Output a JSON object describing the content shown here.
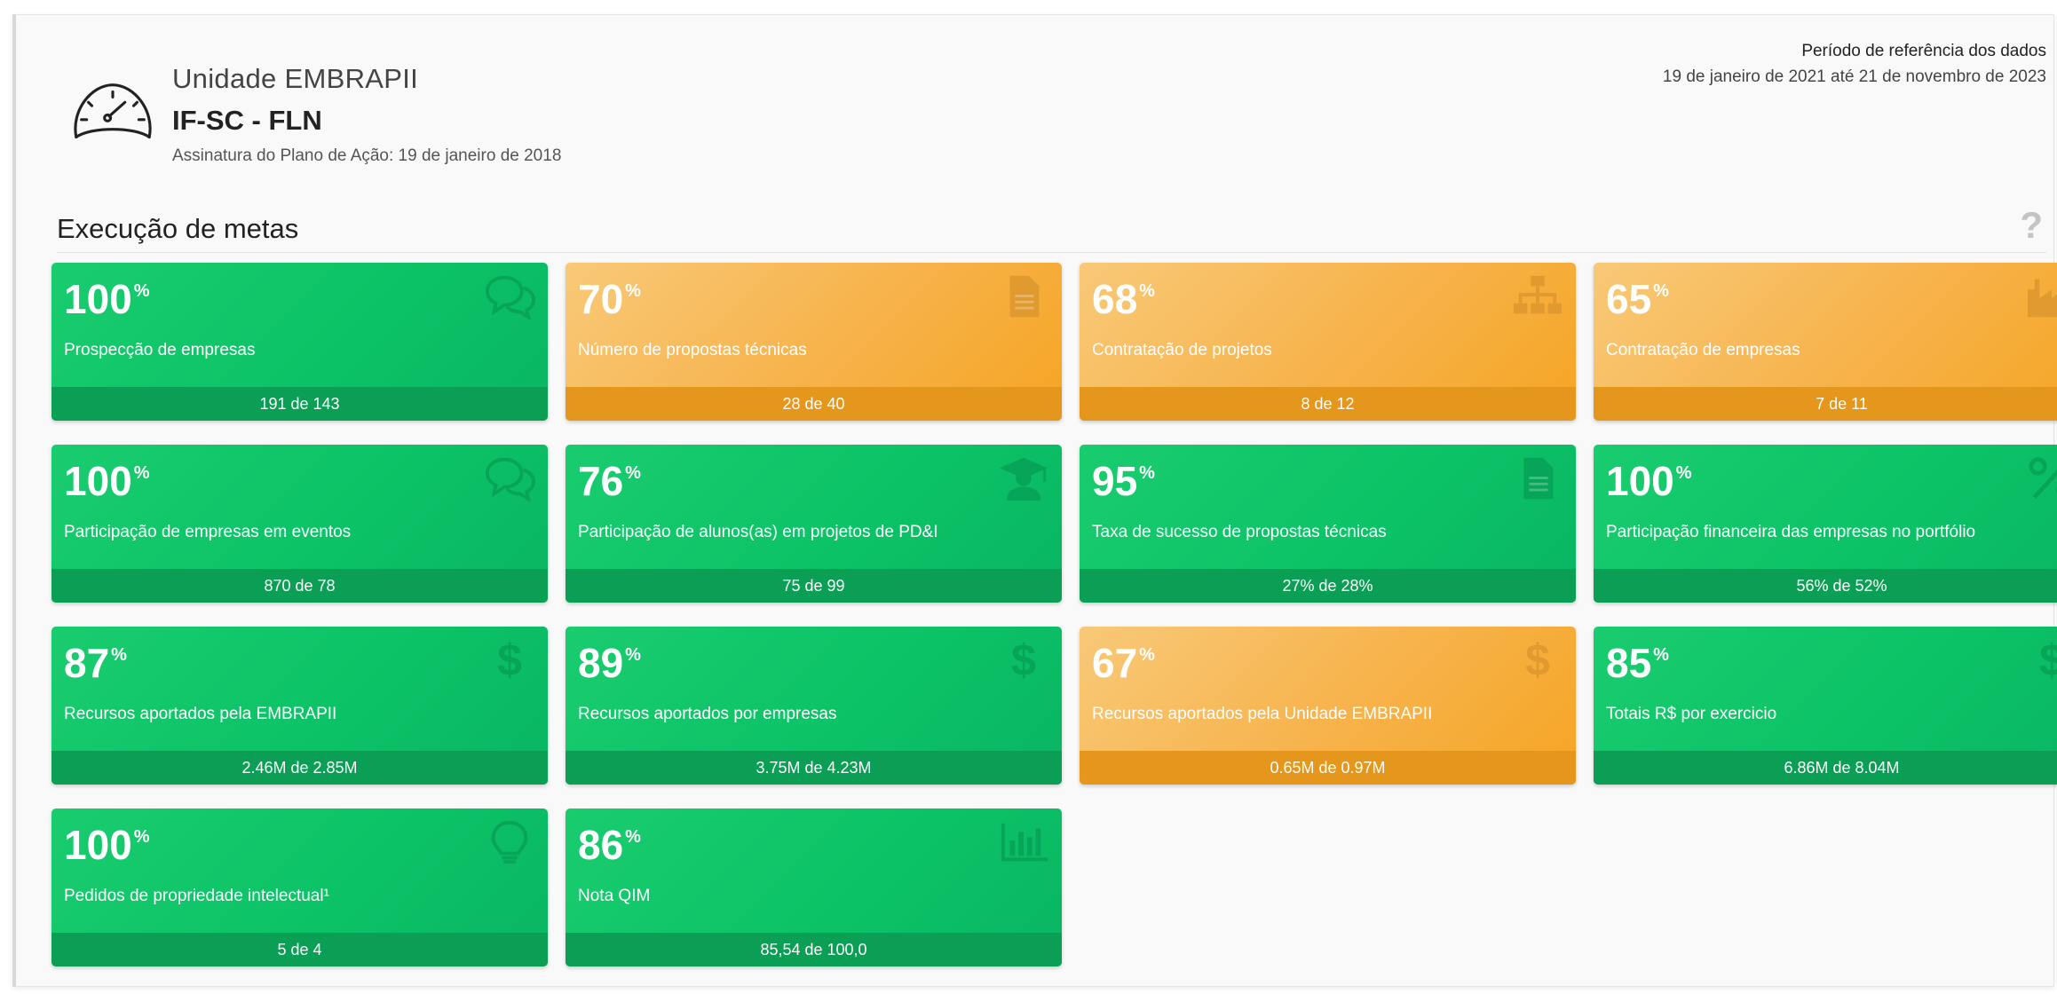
{
  "header": {
    "unit_label": "Unidade EMBRAPII",
    "unit_name": "IF-SC - FLN",
    "signature": "Assinatura do Plano de Ação: 19 de janeiro de 2018",
    "period_title": "Período de referência dos dados",
    "period_range": "19 de janeiro de 2021 até 21 de novembro de 2023",
    "icon": "speedometer-icon"
  },
  "section": {
    "title": "Execução de metas",
    "help_icon": "?"
  },
  "colors": {
    "green": "#0bc266",
    "green_footer": "#0a9f55",
    "orange": "#f7b24a",
    "orange_footer": "#e5961c"
  },
  "cards": [
    {
      "pct": "100",
      "sign": "%",
      "label": "Prospecção de empresas",
      "footer": "191 de 143",
      "status": "green",
      "icon": "chat-bubbles-icon"
    },
    {
      "pct": "70",
      "sign": "%",
      "label": "Número de propostas técnicas",
      "footer": "28 de 40",
      "status": "orange",
      "icon": "document-icon"
    },
    {
      "pct": "68",
      "sign": "%",
      "label": "Contratação de projetos",
      "footer": "8 de 12",
      "status": "orange",
      "icon": "org-chart-icon"
    },
    {
      "pct": "65",
      "sign": "%",
      "label": "Contratação de empresas",
      "footer": "7 de 11",
      "status": "orange",
      "icon": "factory-icon"
    },
    {
      "pct": "100",
      "sign": "%",
      "label": "Participação de empresas em eventos",
      "footer": "870 de 78",
      "status": "green",
      "icon": "chat-bubbles-icon"
    },
    {
      "pct": "76",
      "sign": "%",
      "label": "Participação de alunos(as) em projetos de PD&I",
      "footer": "75 de 99",
      "status": "green",
      "icon": "graduate-icon"
    },
    {
      "pct": "95",
      "sign": "%",
      "label": "Taxa de sucesso de propostas técnicas",
      "footer": "27% de 28%",
      "status": "green",
      "icon": "document-icon"
    },
    {
      "pct": "100",
      "sign": "%",
      "label": "Participação financeira das empresas no portfólio",
      "footer": "56% de 52%",
      "status": "green",
      "icon": "percent-icon"
    },
    {
      "pct": "87",
      "sign": "%",
      "label": "Recursos aportados pela EMBRAPII",
      "footer": "2.46M de 2.85M",
      "status": "green",
      "icon": "dollar-icon"
    },
    {
      "pct": "89",
      "sign": "%",
      "label": "Recursos aportados por empresas",
      "footer": "3.75M de 4.23M",
      "status": "green",
      "icon": "dollar-icon"
    },
    {
      "pct": "67",
      "sign": "%",
      "label": "Recursos aportados pela Unidade EMBRAPII",
      "footer": "0.65M de 0.97M",
      "status": "orange",
      "icon": "dollar-icon"
    },
    {
      "pct": "85",
      "sign": "%",
      "label": "Totais R$ por exercicio",
      "footer": "6.86M de 8.04M",
      "status": "green",
      "icon": "dollar-icon"
    },
    {
      "pct": "100",
      "sign": "%",
      "label": "Pedidos de propriedade intelectual¹",
      "footer": "5 de 4",
      "status": "green",
      "icon": "lightbulb-icon"
    },
    {
      "pct": "86",
      "sign": "%",
      "label": "Nota QIM",
      "footer": "85,54 de 100,0",
      "status": "green",
      "icon": "bar-chart-icon"
    }
  ]
}
